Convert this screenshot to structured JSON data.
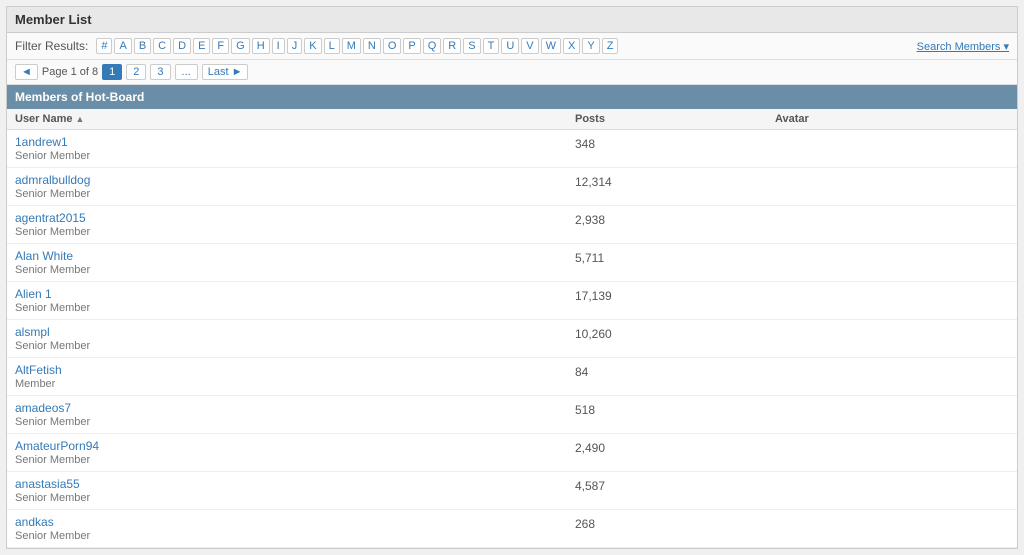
{
  "page": {
    "title": "Member List"
  },
  "toolbar": {
    "filter_label": "Filter Results:",
    "letters": [
      "#",
      "A",
      "B",
      "C",
      "D",
      "E",
      "F",
      "G",
      "H",
      "I",
      "J",
      "K",
      "L",
      "M",
      "N",
      "O",
      "P",
      "Q",
      "R",
      "S",
      "T",
      "U",
      "V",
      "W",
      "X",
      "Y",
      "Z"
    ],
    "search_members": "Search Members ▾"
  },
  "pagination": {
    "prev_label": "◄ Page 1 of 8",
    "pages": [
      "1",
      "2",
      "3",
      "..."
    ],
    "last_label": "Last ►"
  },
  "section": {
    "title": "Members of Hot-Board"
  },
  "columns": {
    "username": "User Name",
    "posts": "Posts",
    "avatar": "Avatar"
  },
  "members": [
    {
      "name": "1andrew1",
      "rank": "Senior Member",
      "posts": "348"
    },
    {
      "name": "admralbulldog",
      "rank": "Senior Member",
      "posts": "12,314"
    },
    {
      "name": "agentrat2015",
      "rank": "Senior Member",
      "posts": "2,938"
    },
    {
      "name": "Alan White",
      "rank": "Senior Member",
      "posts": "5,711"
    },
    {
      "name": "Alien 1",
      "rank": "Senior Member",
      "posts": "17,139"
    },
    {
      "name": "alsmpl",
      "rank": "Senior Member",
      "posts": "10,260"
    },
    {
      "name": "AltFetish",
      "rank": "Member",
      "posts": "84"
    },
    {
      "name": "amadeos7",
      "rank": "Senior Member",
      "posts": "518"
    },
    {
      "name": "AmateurPorn94",
      "rank": "Senior Member",
      "posts": "2,490"
    },
    {
      "name": "anastasia55",
      "rank": "Senior Member",
      "posts": "4,587"
    },
    {
      "name": "andkas",
      "rank": "Senior Member",
      "posts": "268"
    }
  ]
}
